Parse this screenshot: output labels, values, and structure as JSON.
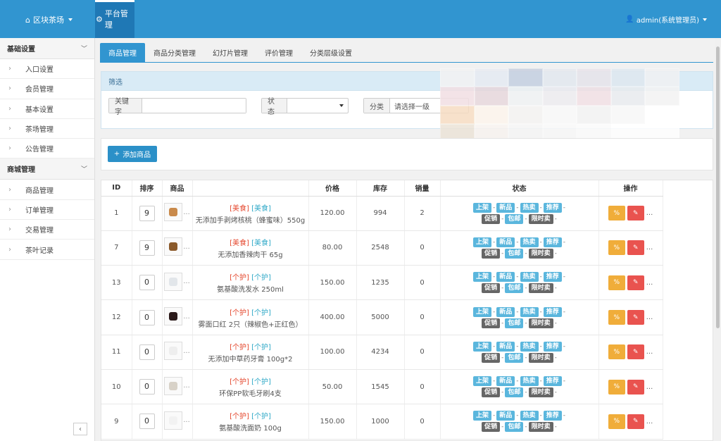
{
  "topbar": {
    "brand": "区块茶场",
    "nav_active": "平台管理",
    "user": "admin(系统管理员)"
  },
  "sidebar": {
    "sections": [
      {
        "title": "基础设置",
        "items": [
          "入口设置",
          "会员管理",
          "基本设置",
          "茶场管理",
          "公告管理"
        ]
      },
      {
        "title": "商城管理",
        "items": [
          "商品管理",
          "订单管理",
          "交易管理",
          "茶叶记录"
        ]
      }
    ],
    "collapse": "‹"
  },
  "tabs": [
    "商品管理",
    "商品分类管理",
    "幻灯片管理",
    "评价管理",
    "分类层级设置"
  ],
  "filter": {
    "heading": "筛选",
    "keyword_label": "关键字",
    "keyword_value": "",
    "status_label": "状态",
    "status_value": "",
    "category_label": "分类",
    "category_value": "请选择一级"
  },
  "add_button": "添加商品",
  "table": {
    "headers": [
      "ID",
      "排序",
      "商品",
      "",
      "价格",
      "库存",
      "销量",
      "状态",
      "操作"
    ],
    "rows": [
      {
        "id": "1",
        "sort": "9",
        "cat1": "[美食]",
        "cat2": "[美食]",
        "name": "无添加手剥烤核桃（蜂蜜味）550g",
        "price": "120.00",
        "stock": "994",
        "sales": "2",
        "thumb": "#c98a4b"
      },
      {
        "id": "7",
        "sort": "9",
        "cat1": "[美食]",
        "cat2": "[美食]",
        "name": "无添加香辣肉干 65g",
        "price": "80.00",
        "stock": "2548",
        "sales": "0",
        "thumb": "#8b5a2b"
      },
      {
        "id": "13",
        "sort": "0",
        "cat1": "[个护]",
        "cat2": "[个护]",
        "name": "氨基酸洗发水 250ml",
        "price": "150.00",
        "stock": "1235",
        "sales": "0",
        "thumb": "#e2e6ea"
      },
      {
        "id": "12",
        "sort": "0",
        "cat1": "[个护]",
        "cat2": "[个护]",
        "name": "雾面口红 2只（辣椒色+正红色）",
        "price": "400.00",
        "stock": "5000",
        "sales": "0",
        "thumb": "#2b1a1a"
      },
      {
        "id": "11",
        "sort": "0",
        "cat1": "[个护]",
        "cat2": "[个护]",
        "name": "无添加中草药牙膏 100g*2",
        "price": "100.00",
        "stock": "4234",
        "sales": "0",
        "thumb": "#eeeeee"
      },
      {
        "id": "10",
        "sort": "0",
        "cat1": "[个护]",
        "cat2": "[个护]",
        "name": "环保PP软毛牙刷4支",
        "price": "50.00",
        "stock": "1545",
        "sales": "0",
        "thumb": "#d8d2c8"
      },
      {
        "id": "9",
        "sort": "0",
        "cat1": "[个护]",
        "cat2": "[个护]",
        "name": "氨基酸洗面奶 100g",
        "price": "150.00",
        "stock": "1000",
        "sales": "0",
        "thumb": "#f2f2f2"
      }
    ],
    "status_badges_row1": [
      "上架",
      "新品",
      "热卖",
      "推荐"
    ],
    "status_badges_row2": [
      "促销",
      "包邮",
      "限时卖"
    ],
    "more": "..."
  },
  "colors": {
    "primary": "#3195d0",
    "warning": "#f0ad3a",
    "danger": "#e9534f",
    "badge_blue": "#5ab6dd",
    "badge_gray": "#666666"
  }
}
